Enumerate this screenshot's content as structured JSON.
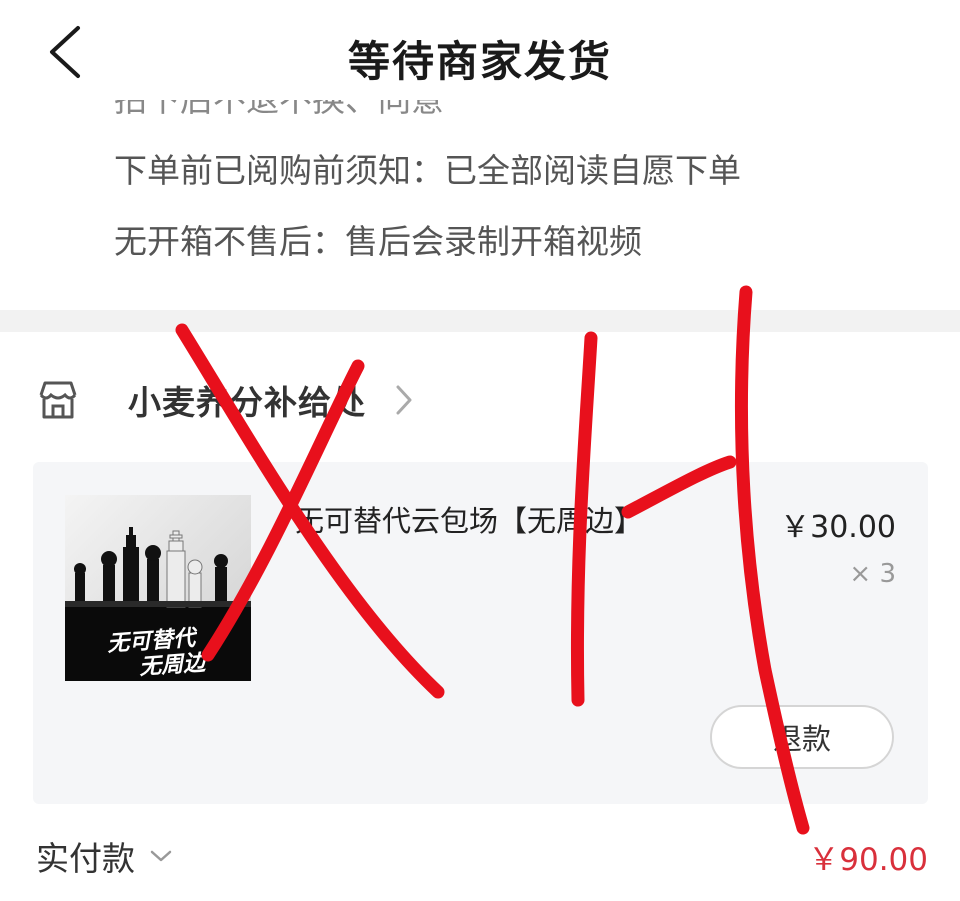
{
  "header": {
    "title": "等待商家发货",
    "back_icon": "chevron-left-icon"
  },
  "notes": [
    {
      "text": "拍下后不退不换、同意"
    },
    {
      "text": "下单前已阅购前须知：已全部阅读自愿下单"
    },
    {
      "text": "无开箱不售后：售后会录制开箱视频"
    }
  ],
  "store": {
    "name": "小麦养分补给处",
    "icon": "store-icon",
    "chevron": "chevron-right-icon"
  },
  "product": {
    "title": "无可替代云包场【无周边】",
    "price": "￥30.00",
    "quantity": "× 3",
    "image_text": [
      "无可替代",
      "无周边"
    ],
    "refund_label": "退款"
  },
  "payment": {
    "label": "实付款",
    "amount": "￥90.00",
    "amount_color": "#d9303b"
  },
  "overlay": {
    "annotation": "red-hand-drawn-strokes",
    "color": "#e8101c"
  }
}
